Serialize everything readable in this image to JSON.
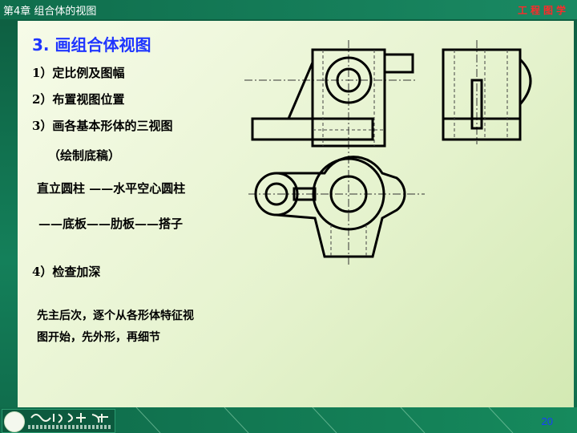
{
  "header": {
    "chapter": "第4章  组合体的视图",
    "brand": "工程图学"
  },
  "slide": {
    "title": "3. 画组合体视图",
    "steps": [
      "1）定比例及图幅",
      "2）布置视图位置",
      "3）画各基本形体的三视图",
      "（绘制底稿）",
      "直立圆柱 ——水平空心圆柱",
      "——底板——肋板——搭子",
      "4）检查加深",
      "先主后次，逐个从各形体特征视",
      "图开始，先外形，再细节"
    ]
  },
  "footer": {
    "page_number": "20"
  },
  "colors": {
    "title": "#1f35ff",
    "brand": "#ff2a2a",
    "frame": "#0f6a4a"
  }
}
